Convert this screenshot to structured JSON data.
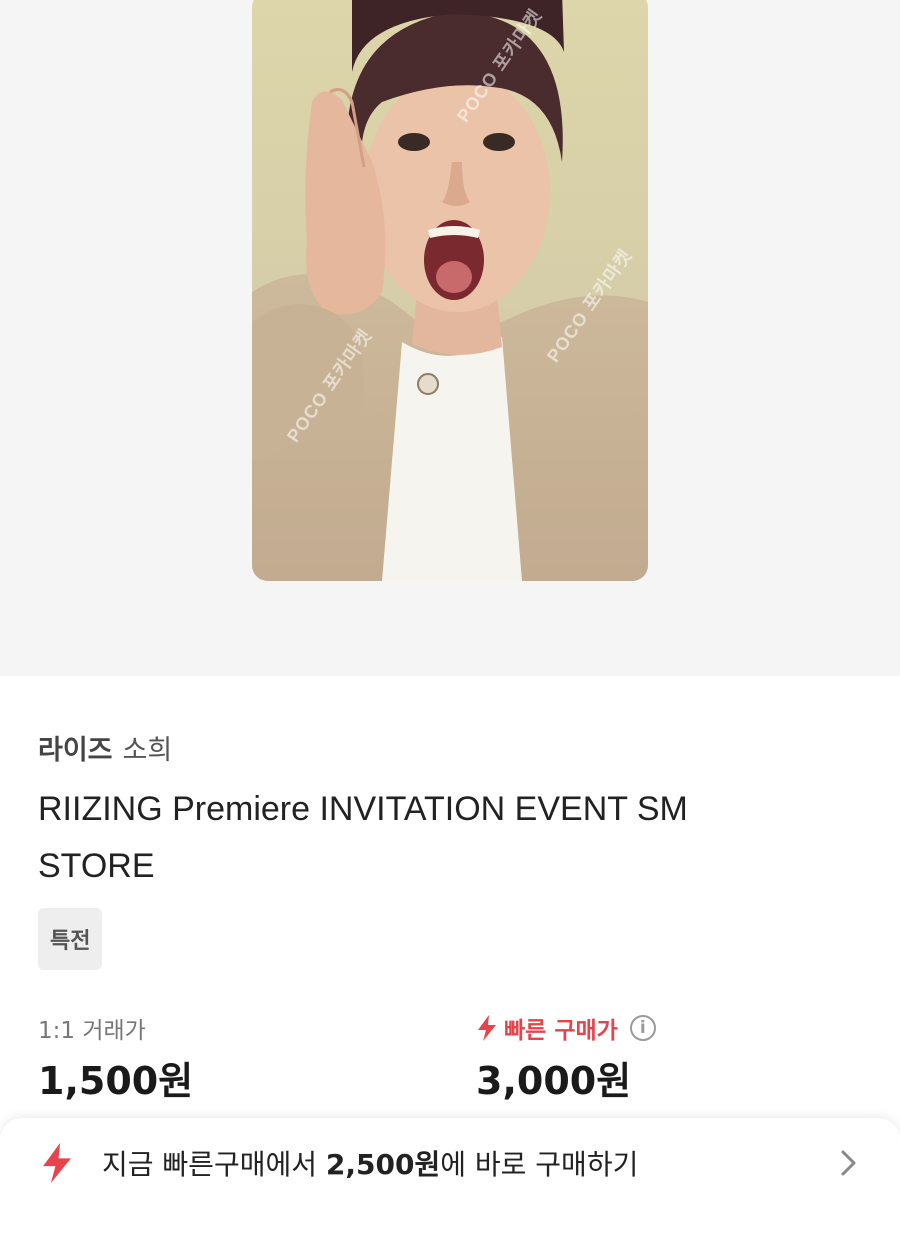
{
  "product": {
    "watermark": "POCO 포카마켓",
    "group": "라이즈",
    "member": "소희",
    "title": "RIIZING Premiere INVITATION EVENT SM STORE",
    "tag": "특전"
  },
  "prices": {
    "direct_label": "1:1 거래가",
    "direct_value": "1,500원",
    "fast_label": "빠른 구매가",
    "fast_value": "3,000원",
    "info_icon": "i"
  },
  "buy_bar": {
    "prefix": "지금 빠른구매에서 ",
    "amount": "2,500원",
    "suffix": "에 바로 구매하기"
  },
  "colors": {
    "accent": "#e8434b",
    "hero_bg": "#f5f5f5"
  },
  "icons": {
    "fast": "lightning-icon",
    "info": "info-icon",
    "chevron": "chevron-right-icon"
  }
}
